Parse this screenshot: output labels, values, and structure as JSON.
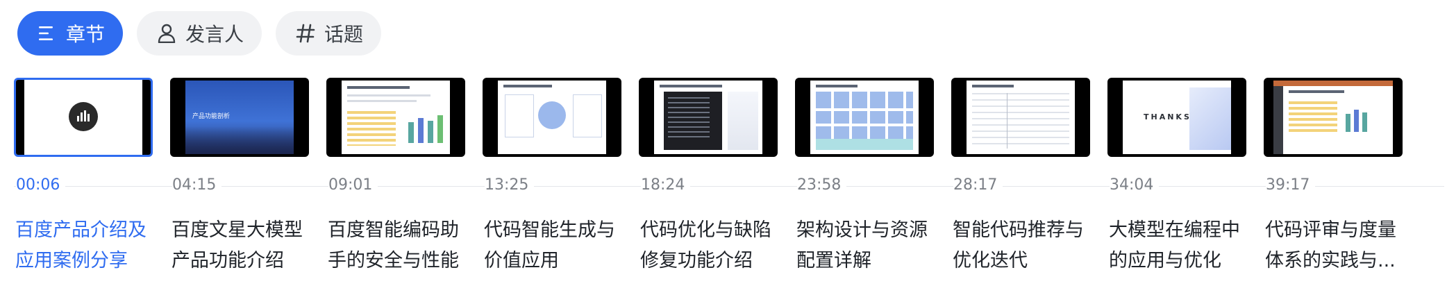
{
  "tabs": [
    {
      "label": "章节",
      "icon": "list-icon",
      "active": true
    },
    {
      "label": "发言人",
      "icon": "person-icon",
      "active": false
    },
    {
      "label": "话题",
      "icon": "hash-icon",
      "active": false
    }
  ],
  "chapters": [
    {
      "time": "00:06",
      "title": "百度产品介绍及应用案例分享",
      "active": true
    },
    {
      "time": "04:15",
      "title": "百度文星大模型产品功能介绍",
      "active": false
    },
    {
      "time": "09:01",
      "title": "百度智能编码助手的安全与性能",
      "active": false
    },
    {
      "time": "13:25",
      "title": "代码智能生成与价值应用",
      "active": false
    },
    {
      "time": "18:24",
      "title": "代码优化与缺陷修复功能介绍",
      "active": false
    },
    {
      "time": "23:58",
      "title": "架构设计与资源配置详解",
      "active": false
    },
    {
      "time": "28:17",
      "title": "智能代码推荐与优化迭代",
      "active": false
    },
    {
      "time": "34:04",
      "title": "大模型在编程中的应用与优化",
      "active": false
    },
    {
      "time": "39:17",
      "title": "代码评审与度量体系的实践与...",
      "active": false
    }
  ],
  "slide_texts": {
    "s2": "产品功能剖析",
    "s8": "THANKS"
  },
  "colors": {
    "accent": "#2f6cf0",
    "tab_bg": "#f1f2f4",
    "muted_text": "#7c8087"
  }
}
